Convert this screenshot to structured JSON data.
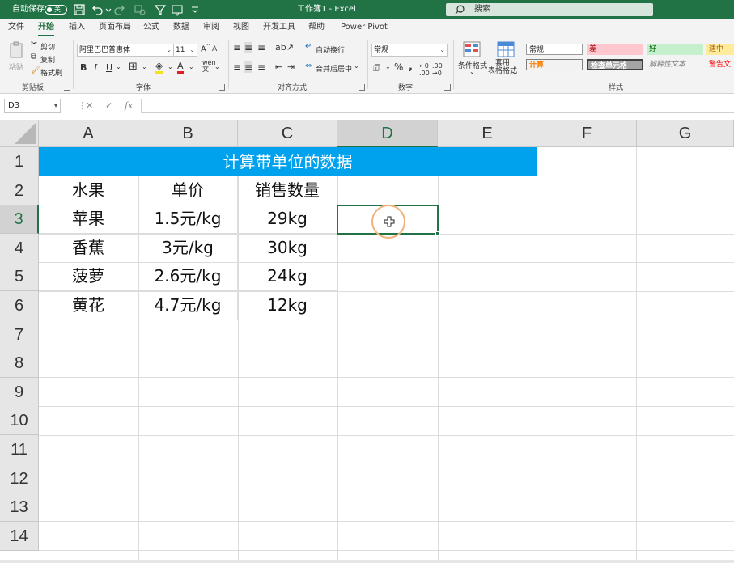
{
  "titlebar": {
    "autosave_label": "自动保存",
    "autosave_state": "关",
    "doc_title": "工作簿1  -  Excel",
    "search_placeholder": "搜索",
    "accent_color": "#217346"
  },
  "ribbon_tabs": [
    {
      "label": "文件"
    },
    {
      "label": "开始",
      "active": true
    },
    {
      "label": "插入"
    },
    {
      "label": "页面布局"
    },
    {
      "label": "公式"
    },
    {
      "label": "数据"
    },
    {
      "label": "审阅"
    },
    {
      "label": "视图"
    },
    {
      "label": "开发工具"
    },
    {
      "label": "帮助"
    },
    {
      "label": "Power Pivot"
    }
  ],
  "ribbon": {
    "clipboard": {
      "paste": "粘贴",
      "cut": "剪切",
      "copy": "复制",
      "format_painter": "格式刷",
      "label": "剪贴板"
    },
    "font": {
      "name": "阿里巴巴普惠体",
      "size": "11",
      "label": "字体"
    },
    "alignment": {
      "wrap": "自动换行",
      "merge": "合并后居中",
      "label": "对齐方式"
    },
    "number": {
      "format": "常规",
      "label": "数字"
    },
    "styles": {
      "conditional": "条件格式",
      "table_format": "套用\n表格格式",
      "label": "样式",
      "items": [
        {
          "label": "常规"
        },
        {
          "label": "差"
        },
        {
          "label": "好"
        },
        {
          "label": "适中"
        },
        {
          "label": "计算"
        },
        {
          "label": "检查单元格"
        },
        {
          "label": "解释性文本"
        },
        {
          "label": "警告文"
        }
      ]
    }
  },
  "formula_bar": {
    "name_box": "D3",
    "content": ""
  },
  "sheet": {
    "columns": [
      "A",
      "B",
      "C",
      "D",
      "E",
      "F",
      "G"
    ],
    "rows": [
      "1",
      "2",
      "3",
      "4",
      "5",
      "6",
      "7",
      "8",
      "9",
      "10",
      "11",
      "12",
      "13",
      "14"
    ],
    "selected_cell": "D3",
    "title": "计算带单位的数据",
    "header": [
      "水果",
      "单价",
      "销售数量"
    ],
    "data": [
      [
        "苹果",
        "1.5元/kg",
        "29kg"
      ],
      [
        "香蕉",
        "3元/kg",
        "30kg"
      ],
      [
        "菠萝",
        "2.6元/kg",
        "24kg"
      ],
      [
        "黄花",
        "4.7元/kg",
        "12kg"
      ]
    ],
    "title_color": "#00a2ed"
  }
}
